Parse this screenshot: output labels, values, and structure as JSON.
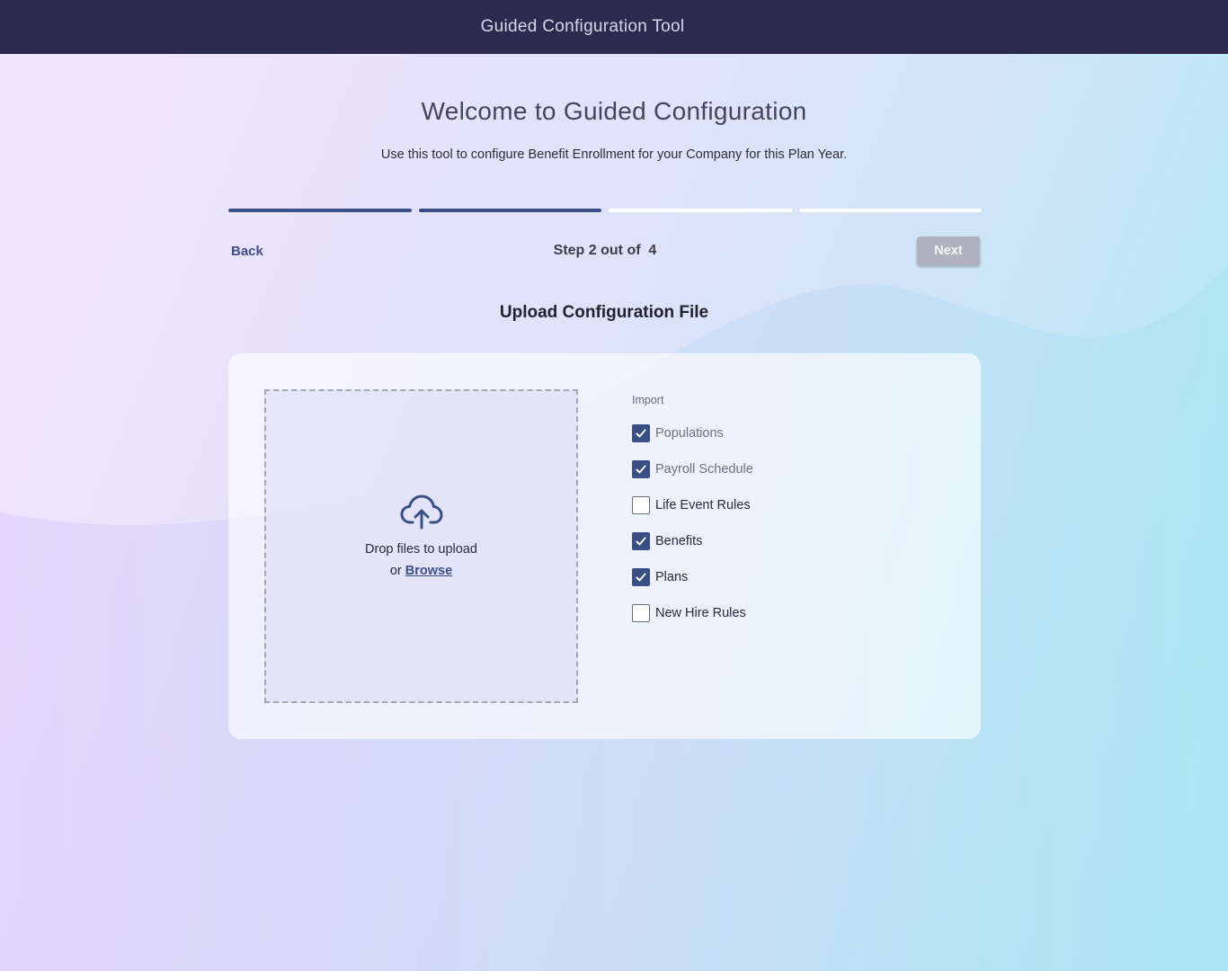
{
  "app": {
    "title": "Guided Configuration Tool"
  },
  "welcome": {
    "title": "Welcome to Guided Configuration",
    "subtitle": "Use this tool to configure Benefit Enrollment for your Company for this Plan Year."
  },
  "progress": {
    "current_step": 2,
    "total_steps": 4
  },
  "nav": {
    "back_label": "Back",
    "step_text": "Step 2 out of  4",
    "next_label": "Next"
  },
  "section": {
    "title": "Upload Configuration File"
  },
  "dropzone": {
    "line1": "Drop files to upload",
    "or_text": "or",
    "browse_label": "Browse",
    "icon": "cloud-upload-icon"
  },
  "import": {
    "label": "Import",
    "items": [
      {
        "label": "Populations",
        "checked": true,
        "disabled": true
      },
      {
        "label": "Payroll Schedule",
        "checked": true,
        "disabled": true
      },
      {
        "label": "Life Event Rules",
        "checked": false,
        "disabled": false
      },
      {
        "label": "Benefits",
        "checked": true,
        "disabled": false
      },
      {
        "label": "Plans",
        "checked": true,
        "disabled": false
      },
      {
        "label": "New Hire Rules",
        "checked": false,
        "disabled": false
      }
    ]
  },
  "colors": {
    "topbar": "#2e2a4f",
    "accent": "#3b4f87",
    "next_disabled": "#b0b3bf"
  }
}
